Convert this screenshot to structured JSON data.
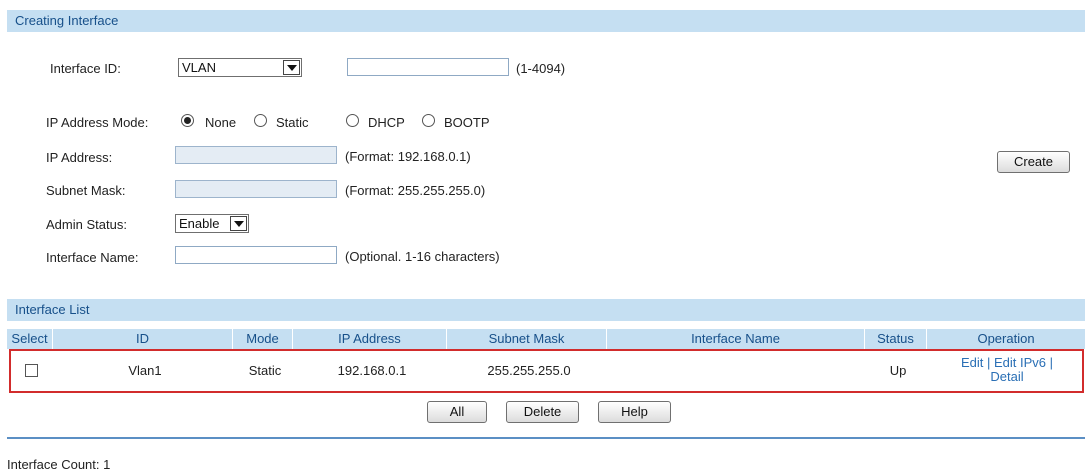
{
  "creating": {
    "header": "Creating Interface",
    "interface_id_label": "Interface ID:",
    "interface_type_value": "VLAN",
    "interface_id_value": "",
    "interface_id_hint": "(1-4094)",
    "ip_mode_label": "IP Address Mode:",
    "ip_modes": [
      {
        "label": "None",
        "checked": true
      },
      {
        "label": "Static",
        "checked": false
      },
      {
        "label": "DHCP",
        "checked": false
      },
      {
        "label": "BOOTP",
        "checked": false
      }
    ],
    "ip_address_label": "IP Address:",
    "ip_address_value": "",
    "ip_address_hint": "(Format: 192.168.0.1)",
    "subnet_mask_label": "Subnet Mask:",
    "subnet_mask_value": "",
    "subnet_mask_hint": "(Format: 255.255.255.0)",
    "admin_status_label": "Admin Status:",
    "admin_status_value": "Enable",
    "interface_name_label": "Interface Name:",
    "interface_name_value": "",
    "interface_name_hint": "(Optional. 1-16 characters)",
    "create_button": "Create"
  },
  "list": {
    "header": "Interface List",
    "columns": [
      "Select",
      "ID",
      "Mode",
      "IP Address",
      "Subnet Mask",
      "Interface Name",
      "Status",
      "Operation"
    ],
    "rows": [
      {
        "selected": false,
        "id": "Vlan1",
        "mode": "Static",
        "ip_address": "192.168.0.1",
        "subnet_mask": "255.255.255.0",
        "interface_name": "",
        "status": "Up",
        "operations": {
          "edit": "Edit",
          "edit_ipv6": "Edit IPv6",
          "detail": "Detail",
          "separator": "|"
        }
      }
    ],
    "buttons": {
      "all": "All",
      "delete": "Delete",
      "help": "Help"
    }
  },
  "footer": {
    "count_text": "Interface Count: 1"
  },
  "colors": {
    "header_bg": "#c5dff2",
    "header_text": "#17508a",
    "highlight_border": "#d22c2c",
    "link": "#2a6fb5"
  }
}
